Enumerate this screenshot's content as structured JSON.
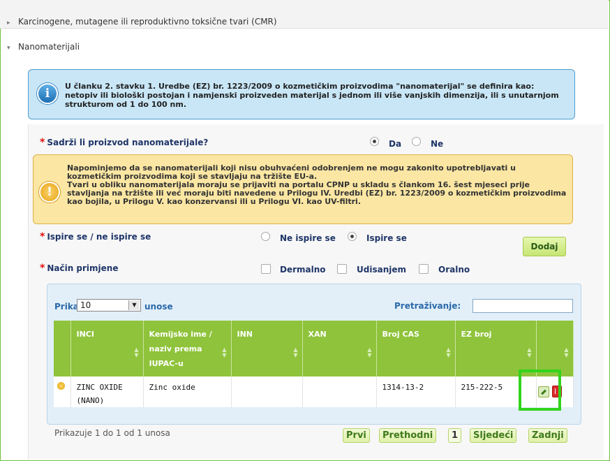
{
  "accordion": {
    "section1": "Karcinogene, mutagene ili reproduktivno toksične tvari (CMR)",
    "section2": "Nanomaterijali"
  },
  "info_box": {
    "text": "U članku 2. stavku 1. Uredbe (EZ) br. 1223/2009 o kozmetičkim proizvodima \"nanomaterijal\" se definira kao: netopiv ili biološki postojan i namjenski proizveden materijal s jednom ili više vanjskih dimenzija, ili s unutarnjom strukturom od 1 do 100 nm."
  },
  "question_nano": {
    "label": "Sadrži li proizvod nanomaterijale?",
    "options": [
      "Da",
      "Ne"
    ],
    "selected": "Da"
  },
  "warning_box": {
    "line1": "Napominjemo da se nanomaterijali koji nisu obuhvaćeni odobrenjem ne mogu zakonito upotrebljavati u kozmetičkim proizvodima koji se stavljaju na tržište EU-a.",
    "line2": "Tvari u obliku nanomaterijala moraju se prijaviti na portalu CPNP u skladu s člankom 16. šest mjeseci prije stavljanja na tržište ili već moraju biti navedene u Prilogu IV. Uredbi (EZ) br. 1223/2009 o kozmetičkim proizvodima kao bojila, u Prilogu V. kao konzervansi ili u Prilogu VI. kao UV-filtri."
  },
  "question_rinse": {
    "label": "Ispire se / ne ispire se",
    "options": [
      "Ne ispire se",
      "Ispire se"
    ],
    "selected": "Ispire se"
  },
  "add_button": "Dodaj",
  "question_route": {
    "label": "Način primjene",
    "options": [
      "Dermalno",
      "Udisanjem",
      "Oralno"
    ]
  },
  "table_controls": {
    "show_label": "Prikaži",
    "length_value": "10",
    "entries_label": "unose",
    "search_label": "Pretraživanje:",
    "search_value": ""
  },
  "table": {
    "headers": [
      "INCI",
      "Kemijsko ime / naziv prema IUPAC-u",
      "INN",
      "XAN",
      "Broj CAS",
      "EZ broj"
    ],
    "rows": [
      {
        "inci": "ZINC OXIDE (NANO)",
        "chem": "Zinc oxide",
        "inn": "",
        "xan": "",
        "cas": "1314-13-2",
        "ez": "215-222-5"
      }
    ]
  },
  "footer": {
    "info": "Prikazuje 1 do 1 od 1 unosa",
    "pagination": [
      "Prvi",
      "Prethodni",
      "1",
      "Sljedeći",
      "Zadnji"
    ]
  },
  "colors": {
    "accent_green": "#8fc33b",
    "highlight": "#32d41c",
    "info_bg": "#c8e6f6",
    "warn_bg": "#fbe6a3"
  }
}
